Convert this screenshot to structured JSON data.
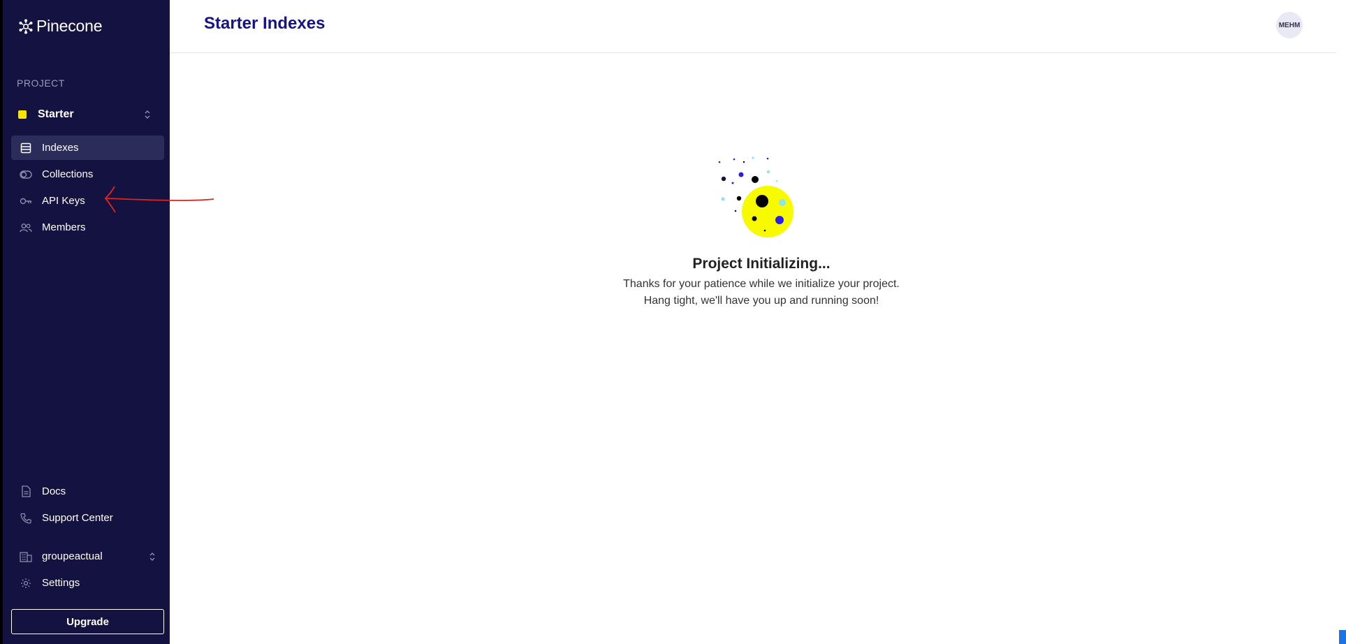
{
  "sidebar": {
    "brand": "Pinecone",
    "section_label": "PROJECT",
    "project": {
      "name": "Starter",
      "color": "#f7e400"
    },
    "nav": [
      {
        "label": "Indexes",
        "icon": "database-icon",
        "active": true
      },
      {
        "label": "Collections",
        "icon": "toggle-icon",
        "active": false
      },
      {
        "label": "API Keys",
        "icon": "key-icon",
        "active": false
      },
      {
        "label": "Members",
        "icon": "users-icon",
        "active": false
      }
    ],
    "footer": [
      {
        "label": "Docs",
        "icon": "document-icon"
      },
      {
        "label": "Support Center",
        "icon": "phone-icon"
      }
    ],
    "organization": {
      "name": "groupeactual",
      "icon": "building-icon"
    },
    "settings_label": "Settings",
    "upgrade_label": "Upgrade"
  },
  "header": {
    "title": "Starter Indexes",
    "avatar_initials": "MEHM"
  },
  "main": {
    "status_title": "Project Initializing...",
    "status_line1": "Thanks for your patience while we initialize your project.",
    "status_line2": "Hang tight, we'll have you up and running soon!"
  },
  "colors": {
    "sidebar_bg": "#141240",
    "title": "#151386",
    "accent_yellow": "#f7e400",
    "annotation": "#e0241b"
  }
}
